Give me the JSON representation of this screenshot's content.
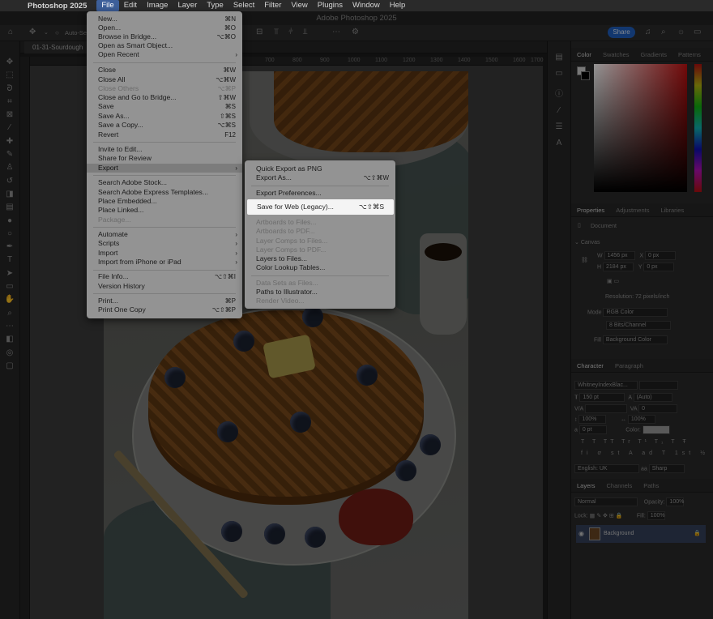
{
  "menubar": {
    "app": "Photoshop 2025",
    "items": [
      "File",
      "Edit",
      "Image",
      "Layer",
      "Type",
      "Select",
      "Filter",
      "View",
      "Plugins",
      "Window",
      "Help"
    ]
  },
  "window_title": "Adobe Photoshop 2025",
  "options_bar": {
    "auto_select": "Auto-Se",
    "share": "Share"
  },
  "document_tab": "01-31-Sourdough",
  "ruler_ticks": [
    "700",
    "800",
    "900",
    "1000",
    "1100",
    "1200",
    "1300",
    "1400",
    "1500",
    "1600",
    "1700"
  ],
  "file_menu": [
    {
      "label": "New...",
      "shortcut": "⌘N"
    },
    {
      "label": "Open...",
      "shortcut": "⌘O"
    },
    {
      "label": "Browse in Bridge...",
      "shortcut": "⌥⌘O"
    },
    {
      "label": "Open as Smart Object...",
      "shortcut": ""
    },
    {
      "label": "Open Recent",
      "shortcut": "",
      "submenu": true
    },
    {
      "label": "Close",
      "shortcut": "⌘W"
    },
    {
      "label": "Close All",
      "shortcut": "⌥⌘W"
    },
    {
      "label": "Close Others",
      "shortcut": "⌥⌘P",
      "disabled": true
    },
    {
      "label": "Close and Go to Bridge...",
      "shortcut": "⇧⌘W"
    },
    {
      "label": "Save",
      "shortcut": "⌘S"
    },
    {
      "label": "Save As...",
      "shortcut": "⇧⌘S"
    },
    {
      "label": "Save a Copy...",
      "shortcut": "⌥⌘S"
    },
    {
      "label": "Revert",
      "shortcut": "F12"
    },
    {
      "label": "Invite to Edit...",
      "shortcut": ""
    },
    {
      "label": "Share for Review",
      "shortcut": ""
    },
    {
      "label": "Export",
      "shortcut": "",
      "submenu": true,
      "highlighted": true
    },
    {
      "label": "Search Adobe Stock...",
      "shortcut": ""
    },
    {
      "label": "Search Adobe Express Templates...",
      "shortcut": ""
    },
    {
      "label": "Place Embedded...",
      "shortcut": ""
    },
    {
      "label": "Place Linked...",
      "shortcut": ""
    },
    {
      "label": "Package...",
      "shortcut": "",
      "disabled": true
    },
    {
      "label": "Automate",
      "shortcut": "",
      "submenu": true
    },
    {
      "label": "Scripts",
      "shortcut": "",
      "submenu": true
    },
    {
      "label": "Import",
      "shortcut": "",
      "submenu": true
    },
    {
      "label": "Import from iPhone or iPad",
      "shortcut": "",
      "submenu": true
    },
    {
      "label": "File Info...",
      "shortcut": "⌥⇧⌘I"
    },
    {
      "label": "Version History",
      "shortcut": ""
    },
    {
      "label": "Print...",
      "shortcut": "⌘P"
    },
    {
      "label": "Print One Copy",
      "shortcut": "⌥⇧⌘P"
    }
  ],
  "export_menu": [
    {
      "label": "Quick Export as PNG",
      "shortcut": ""
    },
    {
      "label": "Export As...",
      "shortcut": "⌥⇧⌘W"
    },
    {
      "label": "Export Preferences...",
      "shortcut": ""
    },
    {
      "label": "Save for Web (Legacy)...",
      "shortcut": "⌥⇧⌘S",
      "highlighted": true
    },
    {
      "label": "Artboards to Files...",
      "shortcut": "",
      "disabled": true
    },
    {
      "label": "Artboards to PDF...",
      "shortcut": "",
      "disabled": true
    },
    {
      "label": "Layer Comps to Files...",
      "shortcut": "",
      "disabled": true
    },
    {
      "label": "Layer Comps to PDF...",
      "shortcut": "",
      "disabled": true
    },
    {
      "label": "Layers to Files...",
      "shortcut": ""
    },
    {
      "label": "Color Lookup Tables...",
      "shortcut": ""
    },
    {
      "label": "Data Sets as Files...",
      "shortcut": "",
      "disabled": true
    },
    {
      "label": "Paths to Illustrator...",
      "shortcut": ""
    },
    {
      "label": "Render Video...",
      "shortcut": "",
      "disabled": true
    }
  ],
  "color_panel": {
    "tabs": [
      "Color",
      "Swatches",
      "Gradients",
      "Patterns"
    ]
  },
  "properties_panel": {
    "tabs": [
      "Properties",
      "Adjustments",
      "Libraries"
    ],
    "type": "Document",
    "section": "Canvas",
    "w": "1456 px",
    "h": "2184 px",
    "x": "0 px",
    "y": "0 px",
    "resolution": "Resolution: 72 pixels/inch",
    "mode_label": "Mode",
    "mode": "RGB Color",
    "depth": "8 Bits/Channel",
    "fill_label": "Fill",
    "fill": "Background Color"
  },
  "character_panel": {
    "tabs": [
      "Character",
      "Paragraph"
    ],
    "font": "WhitneyIndexBlac...",
    "size": "150 pt",
    "leading": "(Auto)",
    "kerning": "",
    "tracking": "0",
    "vscale": "100%",
    "hscale": "100%",
    "baseline": "0 pt",
    "color_label": "Color:",
    "language": "English: UK",
    "aa": "Sharp"
  },
  "layers_panel": {
    "tabs": [
      "Layers",
      "Channels",
      "Paths"
    ],
    "blend": "Normal",
    "opacity_label": "Opacity:",
    "opacity": "100%",
    "lock_label": "Lock:",
    "fill_label": "Fill:",
    "fill": "100%",
    "layer_name": "Background"
  }
}
